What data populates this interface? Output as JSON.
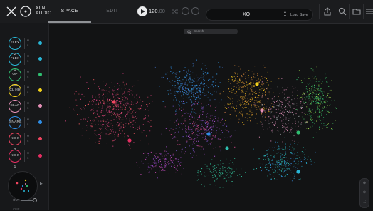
{
  "app": {
    "brand_line1": "XLN",
    "brand_line2": "AUDIO"
  },
  "tabs": [
    {
      "label": "SPACE",
      "active": true
    },
    {
      "label": "EDIT",
      "active": false
    }
  ],
  "transport": {
    "tempo": "120",
    "tempo_decimal": ".00"
  },
  "kit": {
    "name": "XO",
    "load_label": "Load",
    "save_label": "Save"
  },
  "search": {
    "placeholder": "Search"
  },
  "pads": [
    {
      "label": "FLEX 2",
      "color": "#29b6d6"
    },
    {
      "label": "FLEX 1",
      "color": "#29b6d6"
    },
    {
      "label": "OP HH",
      "color": "#2fbf71"
    },
    {
      "label": "CL HH",
      "color": "#f2d11b"
    },
    {
      "label": "CLAP",
      "color": "#e690b7"
    },
    {
      "label": "SNARE",
      "color": "#2f8ee6"
    },
    {
      "label": "KICK 2",
      "color": "#f04560"
    },
    {
      "label": "KICK 1",
      "color": "#e62e62"
    }
  ],
  "pad_meter_labels": {
    "m": "M",
    "s": "S"
  },
  "output": {
    "label": "OUT",
    "label2": "CUE"
  },
  "colors": {
    "background": "#121314",
    "topbar": "#1b1c1e",
    "sidebar": "#17181a"
  }
}
